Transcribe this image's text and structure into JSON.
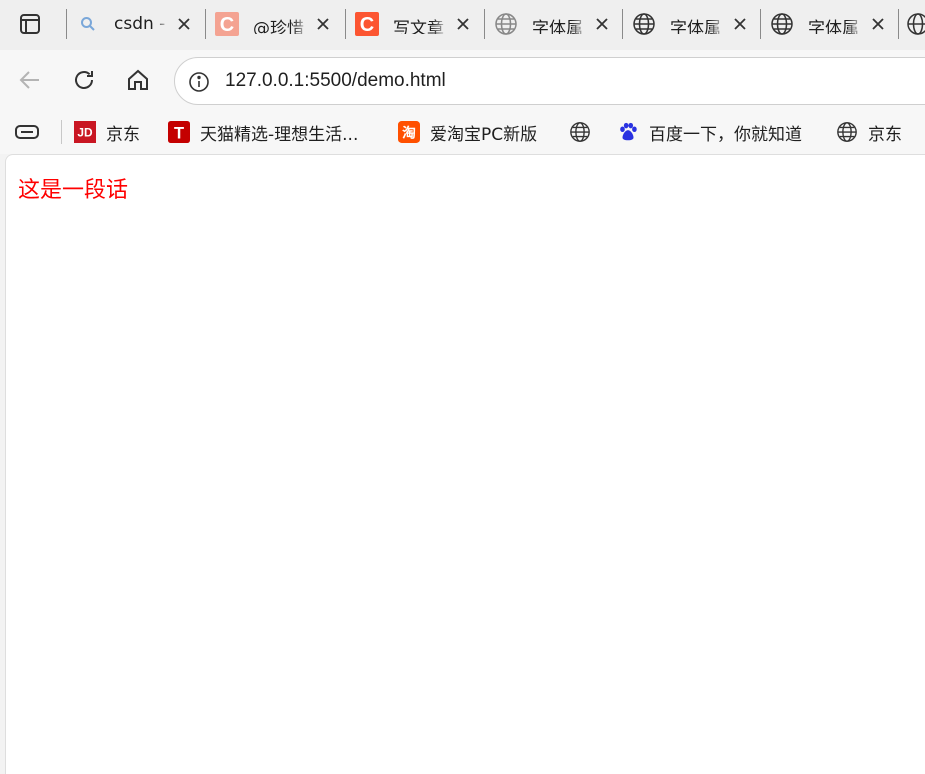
{
  "tabs": [
    {
      "title": "csdn -",
      "icon": "search-icon"
    },
    {
      "title": "@珍惜",
      "icon": "csdn-logo-icon"
    },
    {
      "title": "写文章",
      "icon": "csdn-logo-icon"
    },
    {
      "title": "字体属",
      "icon": "globe-icon"
    },
    {
      "title": "字体属",
      "icon": "globe-icon"
    },
    {
      "title": "字体属",
      "icon": "globe-icon"
    }
  ],
  "address": {
    "url": "127.0.0.1:5500/demo.html"
  },
  "bookmarks": [
    {
      "label": "京东",
      "icon": "jd-logo-icon"
    },
    {
      "label": "天猫精选-理想生活...",
      "icon": "tmall-logo-icon"
    },
    {
      "label": "爱淘宝PC新版",
      "icon": "taobao-logo-icon"
    },
    {
      "label": "",
      "icon": "globe-icon"
    },
    {
      "label": "百度一下，你就知道",
      "icon": "baidu-paw-icon"
    },
    {
      "label": "京东",
      "icon": "globe-icon"
    }
  ],
  "page": {
    "paragraph": "这是一段话",
    "paragraph_color": "#ff0000"
  }
}
